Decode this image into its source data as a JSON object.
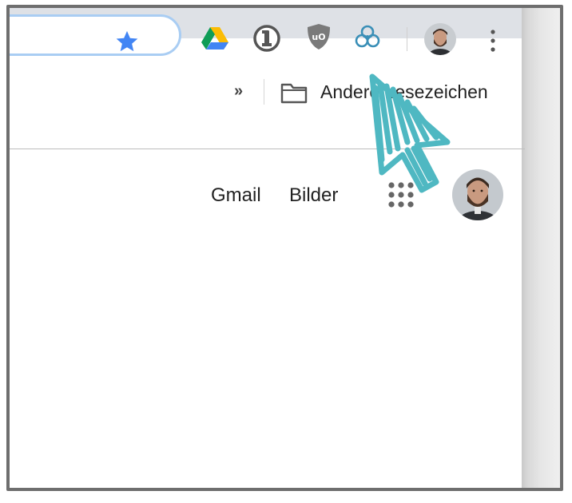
{
  "toolbar": {
    "extensions": [
      {
        "name": "Google Drive",
        "icon": "google-drive-icon"
      },
      {
        "name": "1Password",
        "icon": "1password-icon"
      },
      {
        "name": "uBlock Origin",
        "icon": "ublock-origin-icon"
      },
      {
        "name": "Cursor highlight extension",
        "icon": "cursor-extension-icon"
      }
    ],
    "menu_icon": "kebab-menu-icon",
    "bookmark_star_color": "#4285f4"
  },
  "bookmarks_bar": {
    "overflow_label": "»",
    "other_bookmarks_label": "Andere Lesezeichen"
  },
  "google_header": {
    "gmail_label": "Gmail",
    "images_label": "Bilder",
    "apps_icon": "apps-grid-icon"
  },
  "annotation": {
    "color": "#4fb8c2",
    "icon": "hand-drawn-cursor-arrow"
  }
}
